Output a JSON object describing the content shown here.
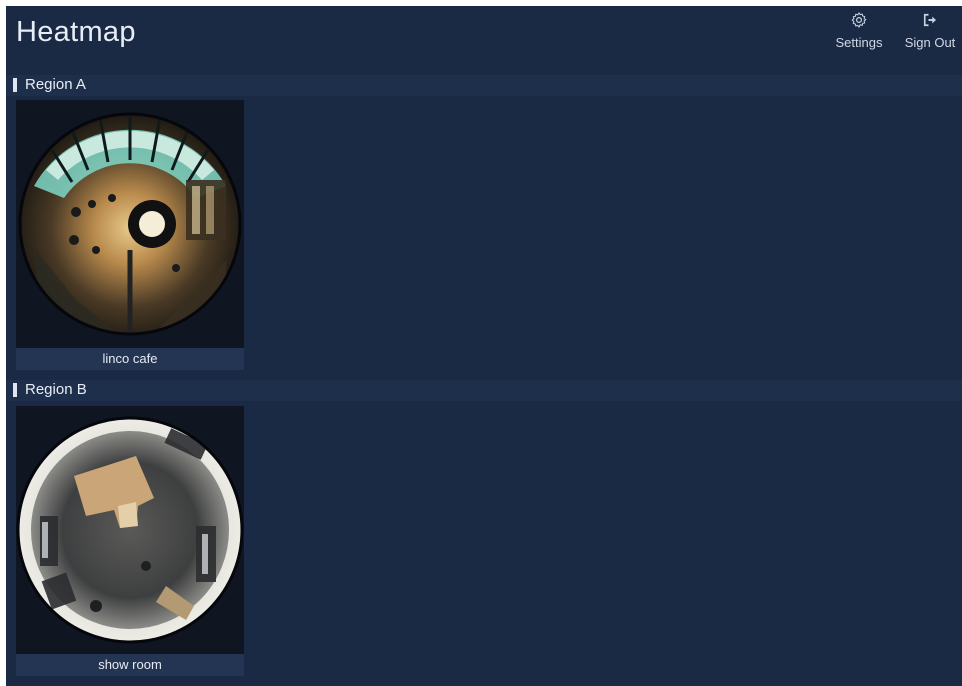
{
  "header": {
    "title": "Heatmap",
    "settings_label": "Settings",
    "signout_label": "Sign Out"
  },
  "regions": [
    {
      "name": "Region A",
      "cameras": [
        {
          "label": "linco cafe",
          "icon": "fisheye-camera-thumbnail"
        }
      ]
    },
    {
      "name": "Region B",
      "cameras": [
        {
          "label": "show room",
          "icon": "fisheye-camera-thumbnail"
        }
      ]
    }
  ],
  "colors": {
    "background": "#1b2a44",
    "region_header": "#1e2f4b",
    "caption_bg": "#233552"
  }
}
